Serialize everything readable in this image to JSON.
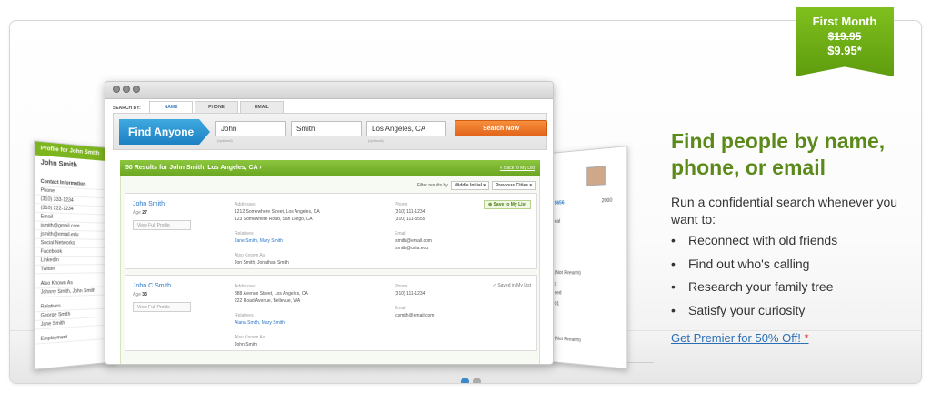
{
  "promo": {
    "line1": "First Month",
    "old_price": "$19.95",
    "new_price": "$9.95*"
  },
  "headline": "Find people by name, phone, or email",
  "lead": "Run a confidential search whenever you want to:",
  "bullets": [
    "Reconnect with old friends",
    "Find out who's calling",
    "Research your family tree",
    "Satisfy your curiosity"
  ],
  "premier_link": "Get Premier for 50% Off!",
  "premier_star": "*",
  "app": {
    "search_by": "SEARCH BY:",
    "tabs": [
      "NAME",
      "PHONE",
      "EMAIL"
    ],
    "find_anyone": "Find Anyone",
    "first_name": "John",
    "last_name": "Smith",
    "location": "Los Angeles, CA",
    "optional": "(optional)",
    "search_now": "Search Now",
    "results_title": "50 Results for John Smith, Los Angeles, CA",
    "back_link": "« Back to My List",
    "filter_label": "Filter results by",
    "filter_middle": "Middle Initial",
    "filter_cities": "Previous Cities",
    "view_full_profile": "View Full Profile",
    "labels": {
      "addresses": "Addresses",
      "relatives": "Relatives",
      "aka": "Also Known As",
      "phone": "Phone",
      "email": "Email"
    },
    "save_to_list": "Save to My List",
    "saved_in_list": "✓ Saved in My List",
    "results": [
      {
        "name": "John Smith",
        "age_label": "Age",
        "age": "27",
        "addresses": [
          "1212 Somewhere Street, Los Angeles, CA",
          "123 Somewhere Road, San Diego, CA"
        ],
        "relatives": "Jane Smith, Mary Smith",
        "aka": "Jon Smith, Jonathan Smith",
        "phones": [
          "(310) 111-1234",
          "(310) 111-5555"
        ],
        "emails": [
          "jsmith@email.com",
          "jsmith@ucla.edu"
        ]
      },
      {
        "name": "John C Smith",
        "age_label": "Age",
        "age": "33",
        "addresses": [
          "888 Avenue Street, Los Angeles, CA",
          "222 Road Avenue, Bellevue, WA"
        ],
        "relatives": "Alana Smith, Mary Smith",
        "aka": "John Smith",
        "phones": [
          "(310) 111-1234"
        ],
        "emails": [
          "jcsmith@email.com"
        ]
      }
    ]
  },
  "left_profile": {
    "bar": "Profile for John Smith",
    "name": "John Smith",
    "contact": "Contact Information",
    "lines": [
      "Phone",
      "(310) 333-1234",
      "(310) 222-1234",
      "Email",
      "jsmith@gmail.com",
      "jsmith@email.edu",
      "Social Networks",
      "Facebook",
      "LinkedIn",
      "Twitter"
    ],
    "aka_title": "Also Known As",
    "aka": "Johnny Smith, John Smith",
    "relatives_title": "Relatives",
    "relatives": [
      "George Smith",
      "Jane Smith"
    ],
    "employment": "Employment"
  },
  "right_profile": {
    "number": "5656",
    "year": "2000",
    "lines": [
      "nal",
      "(Not Firearm)",
      "y",
      "sed",
      "01",
      "(Not Firearm)"
    ]
  },
  "carousel": {
    "active": 0,
    "count": 2
  }
}
